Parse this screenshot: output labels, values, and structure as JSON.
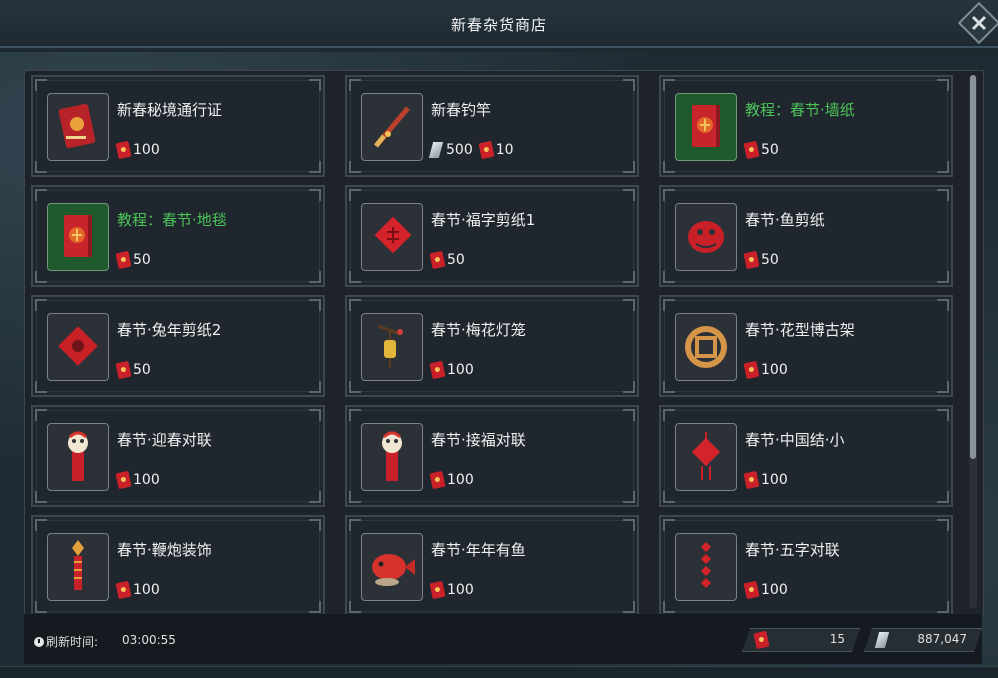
{
  "window": {
    "title": "新春杂货商店"
  },
  "items": [
    {
      "name": "新春秘境通行证",
      "green": false,
      "icon": "pass-book-icon",
      "prices": [
        {
          "currency": "red-envelope",
          "amount": "100"
        }
      ]
    },
    {
      "name": "新春钓竿",
      "green": false,
      "icon": "fishing-rod-icon",
      "prices": [
        {
          "currency": "crystal",
          "amount": "500"
        },
        {
          "currency": "red-envelope",
          "amount": "10"
        }
      ]
    },
    {
      "name": "教程：春节·墙纸",
      "green": true,
      "icon": "tutorial-book-icon",
      "prices": [
        {
          "currency": "red-envelope",
          "amount": "50"
        }
      ]
    },
    {
      "name": "教程：春节·地毯",
      "green": true,
      "icon": "tutorial-book-icon",
      "prices": [
        {
          "currency": "red-envelope",
          "amount": "50"
        }
      ]
    },
    {
      "name": "春节·福字剪纸1",
      "green": false,
      "icon": "fu-papercut-icon",
      "prices": [
        {
          "currency": "red-envelope",
          "amount": "50"
        }
      ]
    },
    {
      "name": "春节·鱼剪纸",
      "green": false,
      "icon": "fish-papercut-icon",
      "prices": [
        {
          "currency": "red-envelope",
          "amount": "50"
        }
      ]
    },
    {
      "name": "春节·兔年剪纸2",
      "green": false,
      "icon": "rabbit-papercut-icon",
      "prices": [
        {
          "currency": "red-envelope",
          "amount": "50"
        }
      ]
    },
    {
      "name": "春节·梅花灯笼",
      "green": false,
      "icon": "plum-lantern-icon",
      "prices": [
        {
          "currency": "red-envelope",
          "amount": "100"
        }
      ]
    },
    {
      "name": "春节·花型博古架",
      "green": false,
      "icon": "flower-shelf-icon",
      "prices": [
        {
          "currency": "red-envelope",
          "amount": "100"
        }
      ]
    },
    {
      "name": "春节·迎春对联",
      "green": false,
      "icon": "couplet-lion-icon",
      "prices": [
        {
          "currency": "red-envelope",
          "amount": "100"
        }
      ]
    },
    {
      "name": "春节·接福对联",
      "green": false,
      "icon": "couplet-lion-icon",
      "prices": [
        {
          "currency": "red-envelope",
          "amount": "100"
        }
      ]
    },
    {
      "name": "春节·中国结·小",
      "green": false,
      "icon": "chinese-knot-icon",
      "prices": [
        {
          "currency": "red-envelope",
          "amount": "100"
        }
      ]
    },
    {
      "name": "春节·鞭炮装饰",
      "green": false,
      "icon": "firecracker-icon",
      "prices": [
        {
          "currency": "red-envelope",
          "amount": "100"
        }
      ]
    },
    {
      "name": "春节·年年有鱼",
      "green": false,
      "icon": "red-fish-icon",
      "prices": [
        {
          "currency": "red-envelope",
          "amount": "100"
        }
      ]
    },
    {
      "name": "春节·五字对联",
      "green": false,
      "icon": "five-char-couplet-icon",
      "prices": [
        {
          "currency": "red-envelope",
          "amount": "100"
        }
      ]
    }
  ],
  "footer": {
    "refresh_label": "刷新时间:",
    "refresh_value": "03:00:55",
    "red_envelope_balance": "15",
    "crystal_balance": "887,047"
  },
  "colors": {
    "green_text": "#4cc45a",
    "envelope_red": "#c9202a",
    "background": "#1e2b33"
  }
}
